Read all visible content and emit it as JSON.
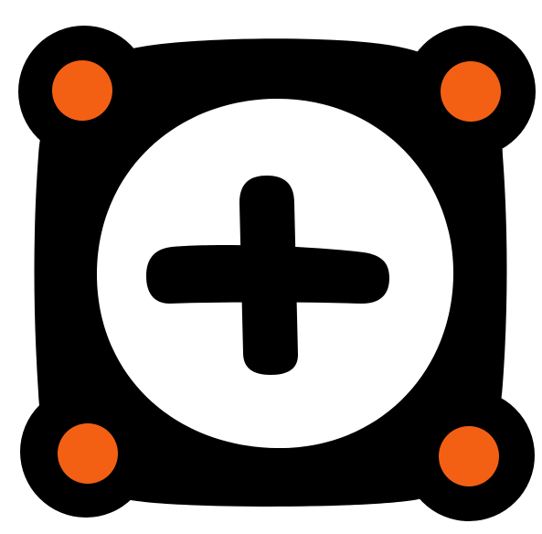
{
  "logo": {
    "icon_name": "plus-in-circle-logo-icon",
    "colors": {
      "frame": "#000000",
      "inner": "#ffffff",
      "dots": "#f36014",
      "plus": "#000000",
      "background": "#ffffff"
    }
  }
}
